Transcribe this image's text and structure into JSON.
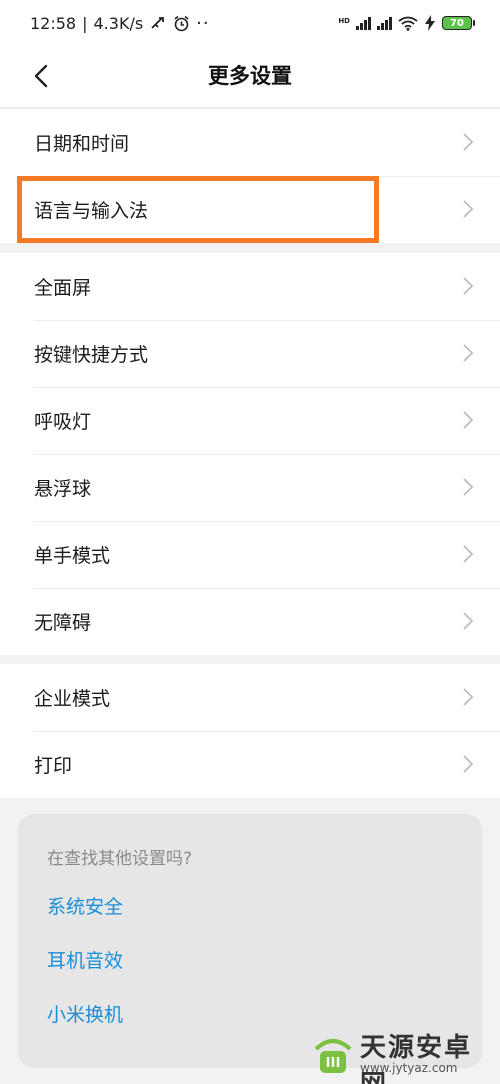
{
  "status_bar": {
    "time": "12:58",
    "speed": "4.3K/s",
    "hd_label": "HD",
    "battery": "70"
  },
  "header": {
    "title": "更多设置"
  },
  "groups": [
    {
      "items": [
        {
          "label": "日期和时间"
        },
        {
          "label": "语言与输入法"
        }
      ]
    },
    {
      "items": [
        {
          "label": "全面屏"
        },
        {
          "label": "按键快捷方式"
        },
        {
          "label": "呼吸灯"
        },
        {
          "label": "悬浮球"
        },
        {
          "label": "单手模式"
        },
        {
          "label": "无障碍"
        }
      ]
    },
    {
      "items": [
        {
          "label": "企业模式"
        },
        {
          "label": "打印"
        }
      ]
    }
  ],
  "suggestions": {
    "question": "在查找其他设置吗?",
    "links": [
      "系统安全",
      "耳机音效",
      "小米换机"
    ]
  },
  "watermark": {
    "name": "天源安卓网",
    "url": "www.jytyaz.com"
  },
  "colors": {
    "accent_link": "#1a8fd8",
    "highlight_box": "#f47a26",
    "battery": "#5dc24a"
  }
}
